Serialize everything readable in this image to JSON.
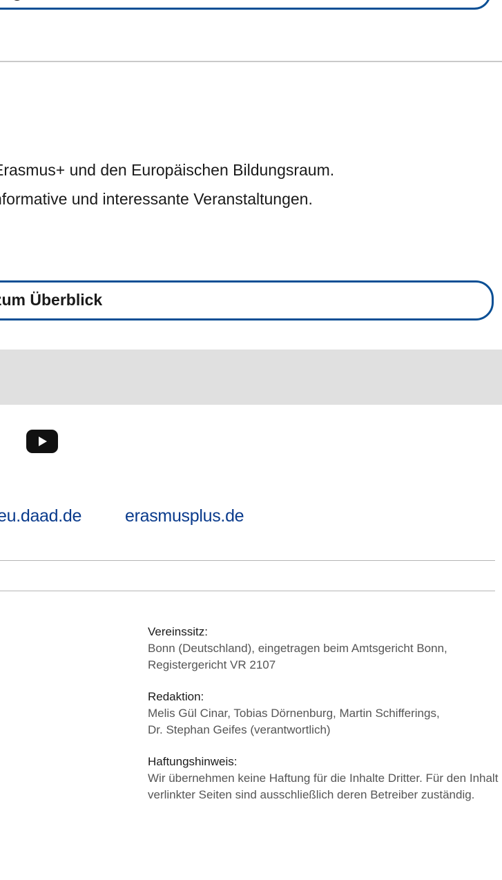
{
  "top_button": {
    "label": "ng"
  },
  "intro": {
    "lines": [
      "Erasmus+ und den Europäischen Bildungsraum.",
      "nformative und interessante Veranstaltungen."
    ]
  },
  "overview_button": {
    "label": "zum Überblick"
  },
  "social": {
    "youtube_icon": "youtube-icon"
  },
  "links": {
    "eu": "eu.daad.de",
    "erasmus": "erasmusplus.de"
  },
  "imprint": {
    "seat": {
      "label": "Vereinssitz:",
      "lines": [
        "Bonn (Deutschland), eingetragen beim Amtsgericht Bonn,",
        "Registergericht VR 2107"
      ]
    },
    "editorial": {
      "label": "Redaktion:",
      "lines": [
        "Melis Gül Cinar, Tobias Dörnenburg, Martin Schifferings,",
        "Dr. Stephan Geifes (verantwortlich)"
      ]
    },
    "liability": {
      "label": "Haftungshinweis:",
      "lines": [
        "Wir übernehmen keine Haftung für die Inhalte Dritter. Für den Inhalt",
        "verlinkter Seiten sind ausschließlich deren Betreiber zuständig."
      ]
    }
  },
  "colors": {
    "brand_blue": "#0a4f95",
    "link_blue": "#0a3b8c",
    "band_grey": "#e0e0e0"
  }
}
